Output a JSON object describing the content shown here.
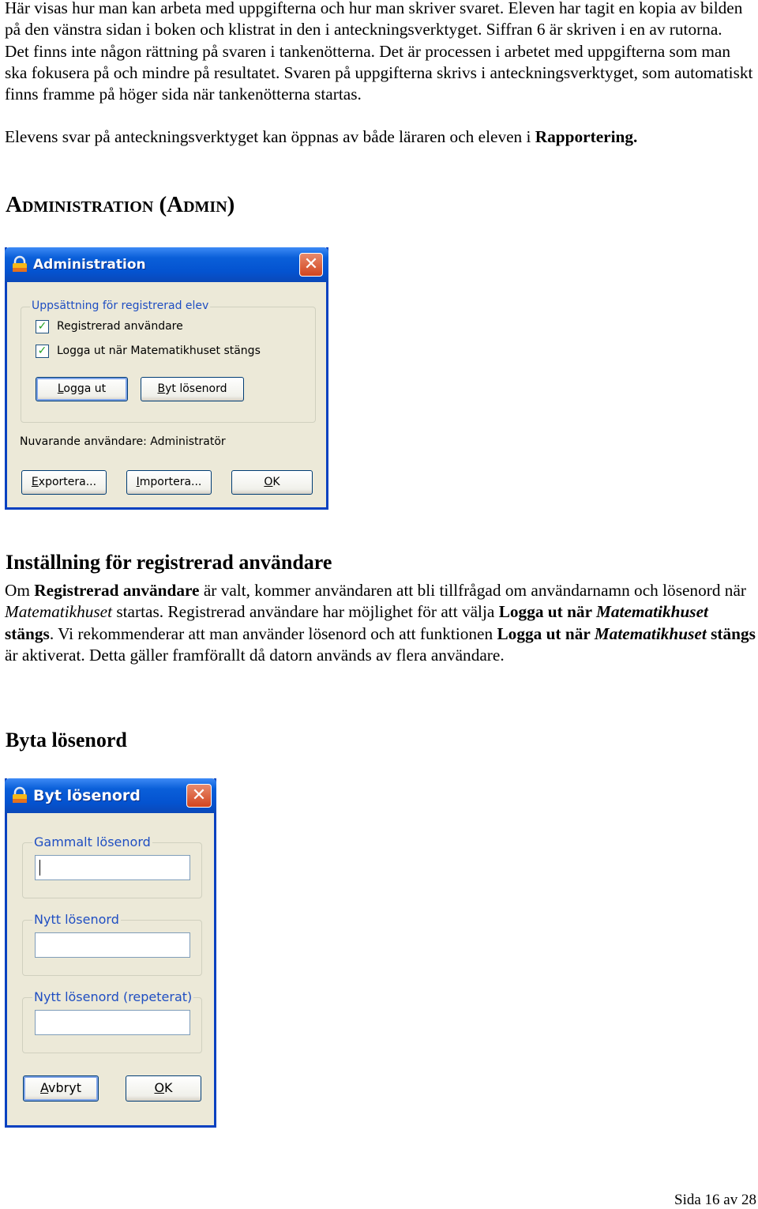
{
  "intro": {
    "p1": "Här visas hur man kan arbeta med uppgifterna och hur man skriver svaret. Eleven har tagit en kopia av bilden på den vänstra sidan i boken och klistrat in den i anteckningsverktyget. Siffran 6 är skriven i en av rutorna.",
    "p2": "Det finns inte någon rättning på svaren i tankenötterna. Det är processen i arbetet med uppgifterna som man ska fokusera på och mindre på resultatet. Svaren på uppgifterna skrivs i anteckningsverktyget, som automatiskt finns framme på höger sida när tankenötterna startas.",
    "p3_text": "Elevens svar på anteckningsverktyget kan öppnas av både läraren och eleven i ",
    "p3_bold": "Rapportering."
  },
  "heading_admin": "Administration (Admin)",
  "admin_dialog": {
    "title": "Administration",
    "group_label": "Uppsättning för registrerad elev",
    "checkboxes": [
      {
        "label": "Registrerad användare",
        "checked": true
      },
      {
        "label": "Logga ut när Matematikhuset stängs",
        "checked": true
      }
    ],
    "logout_button": "Logga ut",
    "change_password_button": "Byt lösenord",
    "current_user": "Nuvarande användare: Administratör",
    "export_button": "Exportera...",
    "import_button": "Importera...",
    "ok_button": "OK"
  },
  "heading_registered": "Inställning för registrerad användare",
  "registered_para": {
    "s1": "Om ",
    "b1": "Registrerad användare",
    "s2": " är valt, kommer användaren att bli tillfrågad om användarnamn och lösenord när ",
    "i1": "Matematikhuset",
    "s3": " startas. Registrerad användare har möjlighet för att välja ",
    "b2": "Logga ut när ",
    "bi2": "Matematikhuset",
    "b2b": " stängs",
    "s4": ". Vi rekommenderar att man använder lösenord och att funktionen ",
    "b3": "Logga ut när ",
    "bi3": "Matematikhuset",
    "b3b": " stängs",
    "s5": " är aktiverat. Detta gäller framförallt då datorn används av flera användare."
  },
  "heading_password": "Byta lösenord",
  "password_dialog": {
    "title": "Byt lösenord",
    "old_label": "Gammalt lösenord",
    "new_label": "Nytt lösenord",
    "repeat_label": "Nytt lösenord (repeterat)",
    "old_value": "",
    "new_value": "",
    "repeat_value": "",
    "cancel_button": "Avbryt",
    "ok_button": "OK"
  },
  "footer": "Sida 16 av 28",
  "colors": {
    "titlebar": "#0a5fd9",
    "dialog_bg": "#ece9d8",
    "group_label": "#1f4ec2",
    "close": "#d2451f",
    "check": "#21a121"
  }
}
